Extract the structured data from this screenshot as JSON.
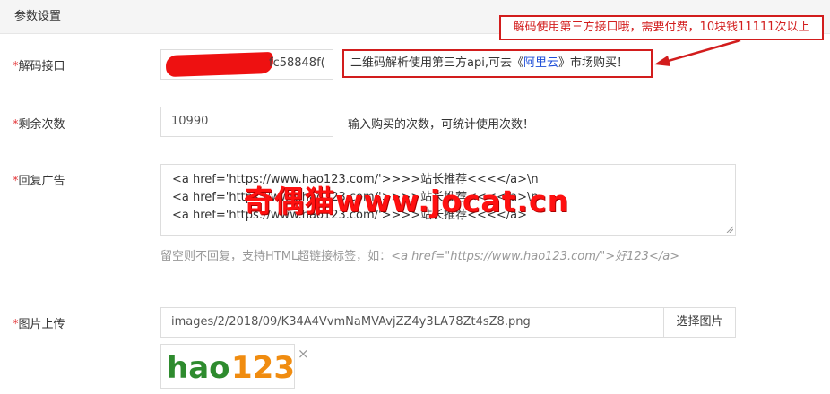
{
  "panel": {
    "title": "参数设置"
  },
  "banner": {
    "text": "解码使用第三方接口哦，需要付费，10块钱11111次以上"
  },
  "fields": {
    "decode_api": {
      "required_mark": "*",
      "label": "解码接口",
      "visible_value_suffix": "fc58848f(",
      "callout_prefix": "二维码解析使用第三方api,可去《",
      "callout_link": "阿里云",
      "callout_suffix": "》市场购买！"
    },
    "remaining": {
      "required_mark": "*",
      "label": "剩余次数",
      "value": "10990",
      "hint": "输入购买的次数，可统计使用次数！"
    },
    "reply_ad": {
      "required_mark": "*",
      "label": "回复广告",
      "lines": [
        "<a href='https://www.hao123.com/'>>>>站长推荐<<<</a>\\n",
        "<a href='https://www.hao123.com/'>>>>站长推荐<<<</a>\\n",
        "<a href='https://www.hao123.com/'>>>>站长推荐<<<</a>"
      ],
      "help_prefix": "留空则不回复，支持HTML超链接标签，如：",
      "help_code": "<a href=\"https://www.hao123.com/\">好123</a>"
    },
    "image_upload": {
      "required_mark": "*",
      "label": "图片上传",
      "value": "images/2/2018/09/K34A4VvmNaMVAvjZZ4y3LA78Zt4sZ8.png",
      "button": "选择图片",
      "close": "×"
    }
  },
  "watermark": {
    "text": "奇偶猫www.jocat.cn"
  },
  "thumbnail": {
    "logo_text": "hao123",
    "logo_main": "hao",
    "logo_num": "123"
  },
  "colors": {
    "annotation": "#d21d1d",
    "link": "#1e4ed8",
    "required": "#e4393c",
    "watermark": "#ff1010"
  }
}
